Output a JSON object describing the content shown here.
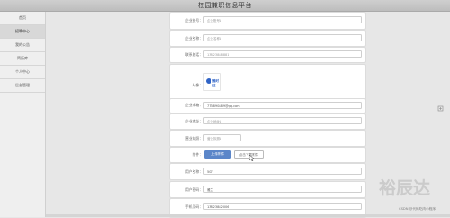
{
  "app": {
    "title": "校园兼职信息平台"
  },
  "sidebar": {
    "items": [
      {
        "label": "首页"
      },
      {
        "label": "招聘中心"
      },
      {
        "label": "我的公告"
      },
      {
        "label": "简历库"
      },
      {
        "label": "个人中心"
      },
      {
        "label": "后台管理"
      }
    ]
  },
  "form": {
    "company_account": {
      "label": "企业账号：",
      "value": "企业账号1"
    },
    "company_name": {
      "label": "企业名称：",
      "value": "企业名称1"
    },
    "contact_phone": {
      "label": "联系电话：",
      "value": "13823888881"
    },
    "logo": {
      "label": "头像：",
      "text": "雅时达"
    },
    "company_email": {
      "label": "企业邮箱：",
      "value": "773890889@qq.com"
    },
    "company_address": {
      "label": "企业地址：",
      "value": "企业地址1"
    },
    "agency_rep": {
      "label": "营业执照：",
      "value": "营业执照1"
    },
    "upload": {
      "label": "附件：",
      "btn1": "上传附件",
      "btn2": "点击下载附件"
    },
    "user_name": {
      "label": "用户名称：",
      "value": "507"
    },
    "user_password": {
      "label": "用户密码：",
      "value": "雅兰"
    },
    "mobile": {
      "label": "手机号码：",
      "value": "13823882006"
    }
  },
  "watermark": {
    "text": "裕辰达"
  },
  "caption": {
    "text": "CSDN @代码吃肉小程序"
  },
  "colors": {
    "accent": "#5b86c9",
    "logo": "#2f63c6"
  }
}
